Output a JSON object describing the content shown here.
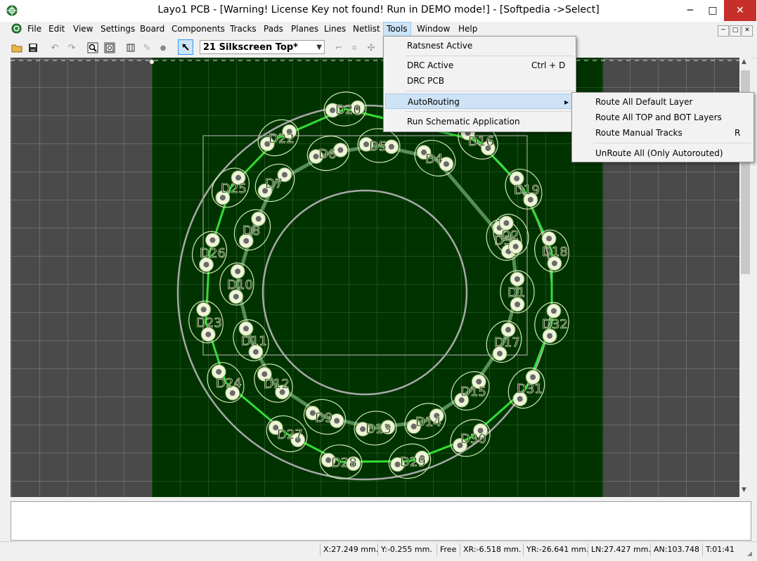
{
  "window": {
    "title": "Layo1 PCB - [Warning! License Key not found! Run in DEMO mode!] - [Softpedia ->Select]",
    "minimize": "─",
    "maximize": "□",
    "close": "✕"
  },
  "menubar": {
    "items": [
      "File",
      "Edit",
      "View",
      "Settings",
      "Board",
      "Components",
      "Tracks",
      "Pads",
      "Planes",
      "Lines",
      "Netlist",
      "Tools",
      "Window",
      "Help"
    ],
    "active": "Tools"
  },
  "toolbar": {
    "layer_select": "21 Silkscreen Top*"
  },
  "tools_menu": {
    "items": [
      {
        "label": "Ratsnest Active",
        "shortcut": ""
      },
      {
        "label": "DRC Active",
        "shortcut": "Ctrl + D"
      },
      {
        "label": "DRC PCB",
        "shortcut": ""
      },
      {
        "label": "AutoRouting",
        "shortcut": ""
      },
      {
        "label": "Run Schematic Application",
        "shortcut": ""
      }
    ],
    "submenu_arrow": "▸"
  },
  "autorouting_submenu": {
    "items": [
      {
        "label": "Route All Default Layer",
        "shortcut": ""
      },
      {
        "label": "Route All TOP and BOT Layers",
        "shortcut": ""
      },
      {
        "label": "Route Manual Tracks",
        "shortcut": "R"
      },
      {
        "label": "UnRoute All (Only Autorouted)",
        "shortcut": ""
      }
    ]
  },
  "pcb": {
    "board_color": "#003300",
    "background_color": "#4a4a4a",
    "track_color": "#33dd33",
    "silkscreen_color": "#cfe8b0",
    "components": [
      {
        "ref": "D20"
      },
      {
        "ref": "D22"
      },
      {
        "ref": "D6"
      },
      {
        "ref": "D5"
      },
      {
        "ref": "D4"
      },
      {
        "ref": "D16"
      },
      {
        "ref": "D25"
      },
      {
        "ref": "D7"
      },
      {
        "ref": "D3"
      },
      {
        "ref": "D19"
      },
      {
        "ref": "D8"
      },
      {
        "ref": "D26"
      },
      {
        "ref": "D2"
      },
      {
        "ref": "D18"
      },
      {
        "ref": "D10"
      },
      {
        "ref": "D1"
      },
      {
        "ref": "D23"
      },
      {
        "ref": "D32"
      },
      {
        "ref": "D11"
      },
      {
        "ref": "D17"
      },
      {
        "ref": "D24"
      },
      {
        "ref": "D12"
      },
      {
        "ref": "D15"
      },
      {
        "ref": "D31"
      },
      {
        "ref": "D9"
      },
      {
        "ref": "D13"
      },
      {
        "ref": "D14"
      },
      {
        "ref": "D27"
      },
      {
        "ref": "D30"
      },
      {
        "ref": "D28"
      },
      {
        "ref": "D29"
      }
    ]
  },
  "statusbar": {
    "x": "X:27.249 mm.",
    "y": "Y:-0.255 mm.",
    "mode": "Free",
    "xr": "XR:-6.518 mm.",
    "yr": "YR:-26.641 mm.",
    "ln": "LN:27.427 mm.",
    "an": "AN:103.748",
    "t": "T:01:41"
  }
}
